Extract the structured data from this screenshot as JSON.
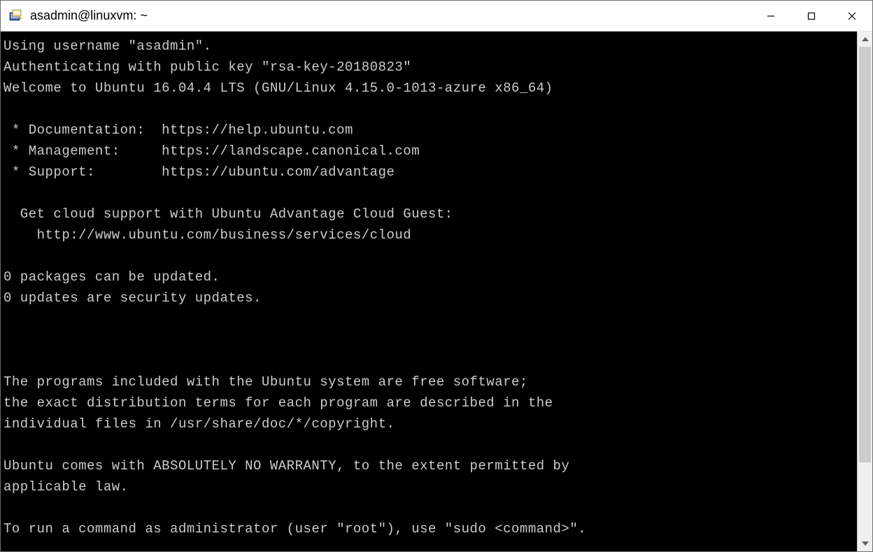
{
  "window": {
    "title": "asadmin@linuxvm: ~"
  },
  "terminal": {
    "lines": [
      "Using username \"asadmin\".",
      "Authenticating with public key \"rsa-key-20180823\"",
      "Welcome to Ubuntu 16.04.4 LTS (GNU/Linux 4.15.0-1013-azure x86_64)",
      "",
      " * Documentation:  https://help.ubuntu.com",
      " * Management:     https://landscape.canonical.com",
      " * Support:        https://ubuntu.com/advantage",
      "",
      "  Get cloud support with Ubuntu Advantage Cloud Guest:",
      "    http://www.ubuntu.com/business/services/cloud",
      "",
      "0 packages can be updated.",
      "0 updates are security updates.",
      "",
      "",
      "",
      "The programs included with the Ubuntu system are free software;",
      "the exact distribution terms for each program are described in the",
      "individual files in /usr/share/doc/*/copyright.",
      "",
      "Ubuntu comes with ABSOLUTELY NO WARRANTY, to the extent permitted by",
      "applicable law.",
      "",
      "To run a command as administrator (user \"root\"), use \"sudo <command>\"."
    ]
  }
}
